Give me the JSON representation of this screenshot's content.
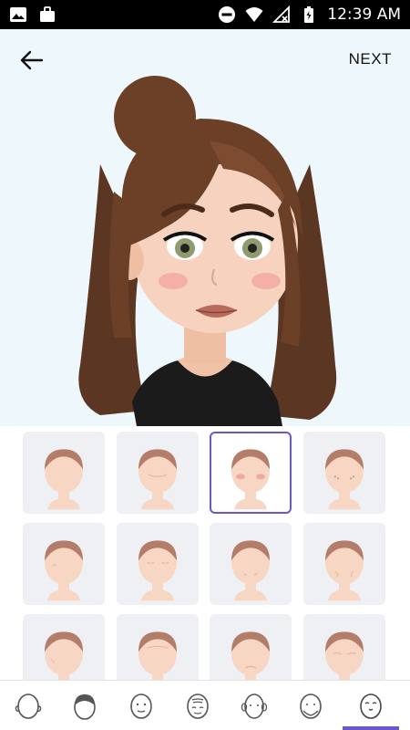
{
  "status_bar": {
    "time": "12:39 AM",
    "left_icons": [
      "image-icon",
      "briefcase-icon"
    ],
    "right_icons": [
      "do-not-disturb-icon",
      "wifi-icon",
      "no-signal-icon",
      "battery-icon"
    ]
  },
  "header": {
    "back_icon": "arrow-left-icon",
    "next_label": "NEXT"
  },
  "colors": {
    "header_bg": "#eef7fb",
    "accent": "#6a58c9",
    "tile_bg": "#eff0f4",
    "skin": "#f7d7c4",
    "hair": "#b37d6a"
  },
  "face_options": {
    "count_visible": 12,
    "selected_index": 2
  },
  "bottom_tabs": {
    "items": [
      "face-shape-icon",
      "hair-icon",
      "face-icon",
      "wrinkle-face-icon",
      "ear-face-icon",
      "cheek-face-icon",
      "nose-face-icon"
    ],
    "active_index": 6
  }
}
